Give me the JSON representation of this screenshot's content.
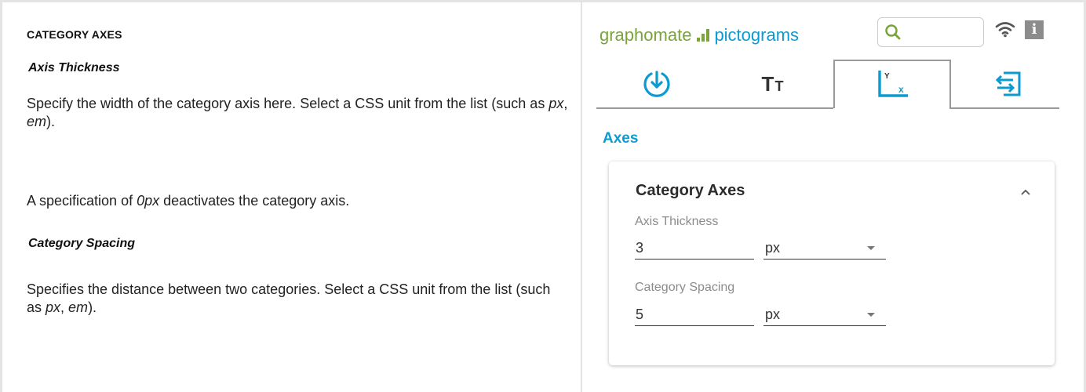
{
  "doc": {
    "heading": "CATEGORY AXES",
    "sections": [
      {
        "subheading": "Axis Thickness",
        "paragraphs": [
          {
            "parts": [
              "Specify the width of the category axis here. Select a CSS unit from the list (such as ",
              "px",
              ", ",
              "em",
              ")."
            ]
          },
          {
            "parts": [
              "A specification of ",
              "0px",
              " deactivates the category axis."
            ]
          }
        ]
      },
      {
        "subheading": "Category Spacing",
        "paragraphs": [
          {
            "parts": [
              "Specifies the distance between two categories. Select a CSS unit from the list (such as ",
              "px",
              ", ",
              "em",
              ")."
            ]
          }
        ]
      }
    ]
  },
  "panel": {
    "brand": {
      "part1": "grapho",
      "part2": "mate",
      "part3": "pictograms"
    },
    "search": {
      "value": "",
      "placeholder": ""
    },
    "tabs": [
      {
        "icon": "download-circle-icon",
        "active": false
      },
      {
        "icon": "text-size-icon",
        "label_big": "T",
        "label_small": "T",
        "active": false
      },
      {
        "icon": "axes-icon",
        "axis_y": "Y",
        "axis_x": "x",
        "active": true
      },
      {
        "icon": "export-icon",
        "active": false
      }
    ],
    "section_title": "Axes",
    "card": {
      "title": "Category Axes",
      "fields": [
        {
          "label": "Axis Thickness",
          "value": "3",
          "unit": "px"
        },
        {
          "label": "Category Spacing",
          "value": "5",
          "unit": "px"
        }
      ]
    }
  },
  "colors": {
    "accent": "#0b9bd1",
    "brand_green": "#7aa33a"
  }
}
